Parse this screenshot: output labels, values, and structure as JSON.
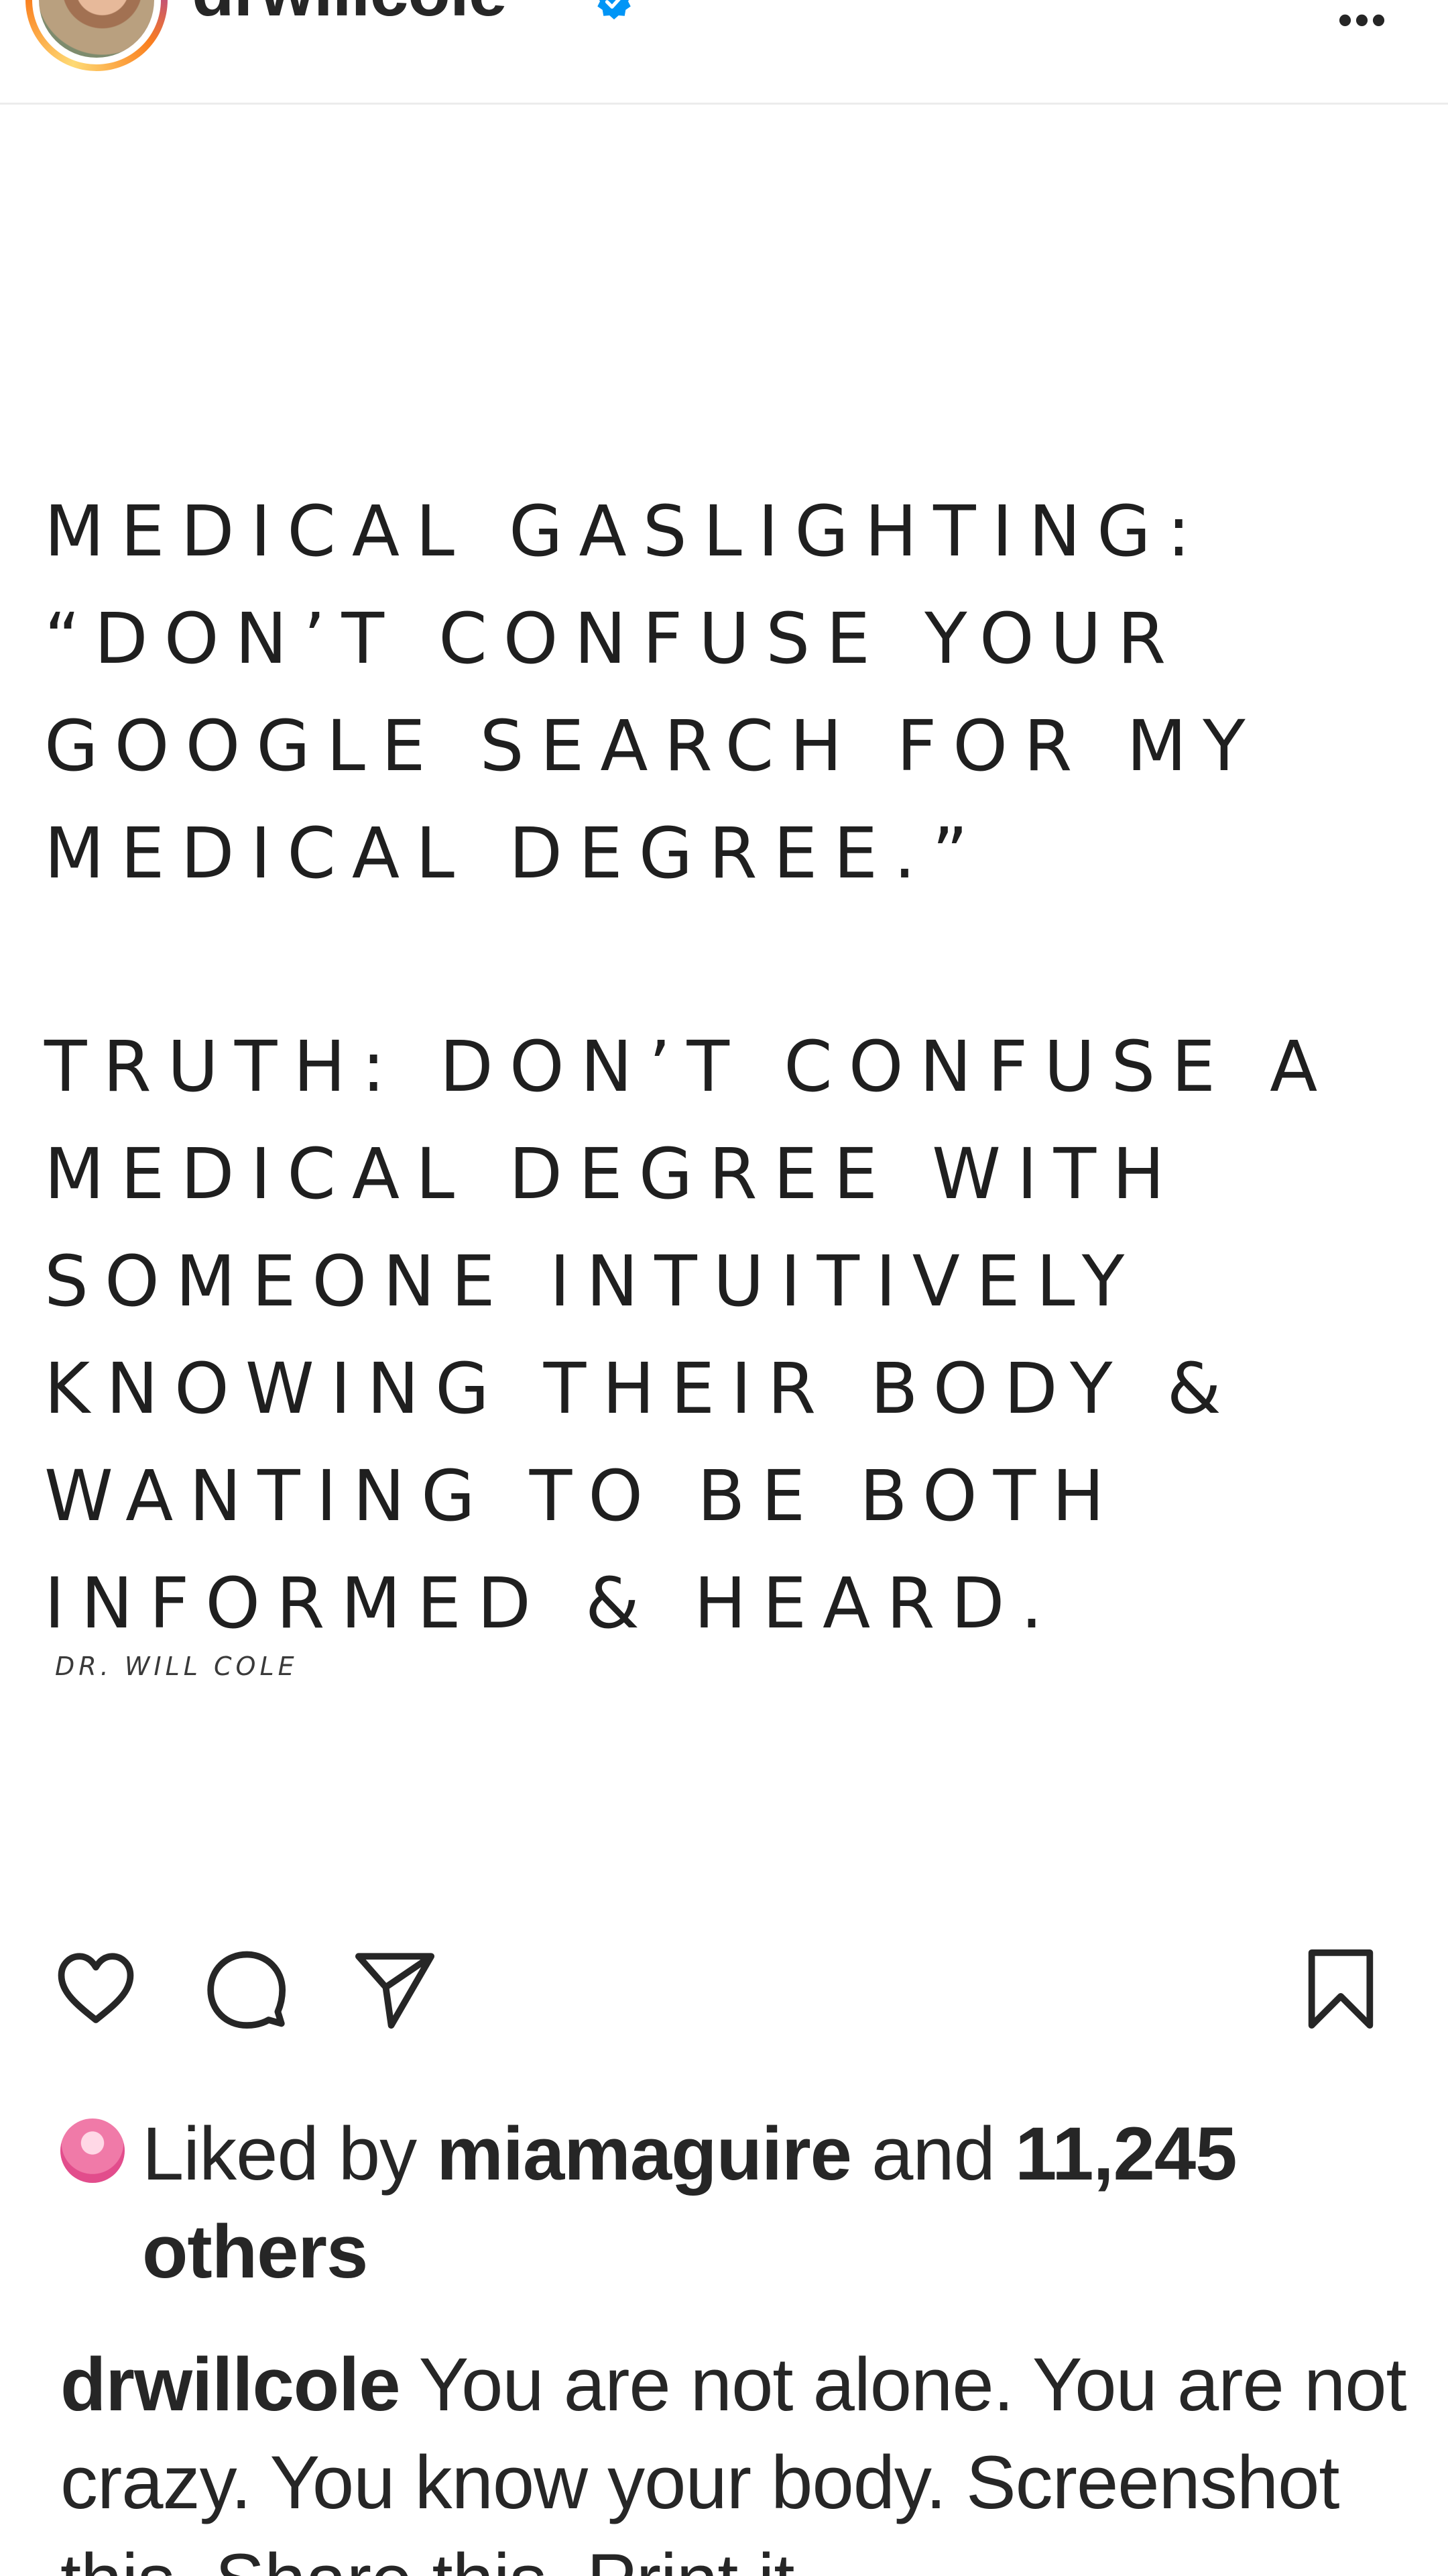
{
  "header": {
    "username": "drwillcole",
    "verified_icon": "verified-badge-icon",
    "more_label": "•••"
  },
  "post": {
    "lines": [
      "MEDICAL GASLIGHTING:",
      "“DON’T CONFUSE YOUR",
      "GOOGLE SEARCH FOR MY",
      "MEDICAL DEGREE.”",
      "TRUTH: DON’T CONFUSE A",
      "MEDICAL DEGREE WITH",
      "SOMEONE INTUITIVELY",
      "KNOWING THEIR BODY &",
      "WANTING TO BE BOTH",
      "INFORMED & HEARD."
    ],
    "signature": "DR. WILL COLE"
  },
  "actions": {
    "icons": [
      "heart-icon",
      "comment-icon",
      "share-icon",
      "bookmark-icon"
    ]
  },
  "likes": {
    "prefix": "Liked by",
    "user": "miamaguire",
    "connector": "and",
    "count": "11,245",
    "suffix": "others"
  },
  "caption": {
    "user": "drwillcole",
    "text": "You are not alone. You are not crazy. You know your body. Screenshot this. Share this. Print it"
  },
  "colors": {
    "text": "#262626",
    "verified": "#0095f6",
    "divider": "#ececec"
  }
}
